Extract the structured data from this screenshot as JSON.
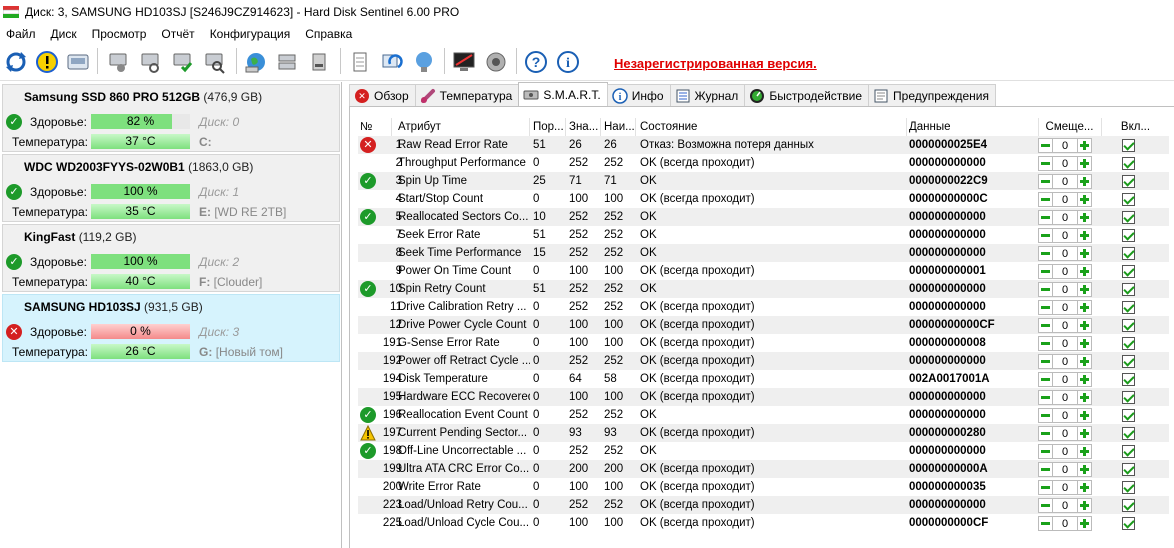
{
  "window": {
    "title": "Диск: 3, SAMSUNG HD103SJ [S246J9CZ914623]  -  Hard Disk Sentinel 6.00 PRO"
  },
  "menu": [
    "Файл",
    "Диск",
    "Просмотр",
    "Отчёт",
    "Конфигурация",
    "Справка"
  ],
  "toolbar": {
    "unregistered": "Незарегистрированная версия."
  },
  "disks": [
    {
      "name": "Samsung SSD 860 PRO 512GB",
      "size": "(476,9 GB)",
      "health_label": "Здоровье:",
      "health": "82 %",
      "health_level": 82,
      "disk_label": "Диск: 0",
      "temp_label": "Температура:",
      "temp": "37 °C",
      "volume_letter": "C:",
      "volume_name": "",
      "status": "ok",
      "selected": false
    },
    {
      "name": "WDC WD2003FYYS-02W0B1",
      "size": "(1863,0 GB)",
      "health_label": "Здоровье:",
      "health": "100 %",
      "health_level": 100,
      "disk_label": "Диск: 1",
      "temp_label": "Температура:",
      "temp": "35 °C",
      "volume_letter": "E:",
      "volume_name": "[WD RE 2TB]",
      "status": "ok",
      "selected": false
    },
    {
      "name": "KingFast",
      "size": "(119,2 GB)",
      "health_label": "Здоровье:",
      "health": "100 %",
      "health_level": 100,
      "disk_label": "Диск: 2",
      "temp_label": "Температура:",
      "temp": "40 °C",
      "volume_letter": "F:",
      "volume_name": "[Clouder]",
      "status": "ok",
      "selected": false
    },
    {
      "name": "SAMSUNG HD103SJ",
      "size": "(931,5 GB)",
      "health_label": "Здоровье:",
      "health": "0 %",
      "health_level": 0,
      "disk_label": "Диск: 3",
      "temp_label": "Температура:",
      "temp": "26 °C",
      "volume_letter": "G:",
      "volume_name": "[Новый том]",
      "status": "bad",
      "selected": true
    }
  ],
  "tabs": [
    {
      "label": "Обзор",
      "icon": "error-icon"
    },
    {
      "label": "Температура",
      "icon": "thermometer-icon"
    },
    {
      "label": "S.M.A.R.T.",
      "icon": "disk-icon",
      "active": true
    },
    {
      "label": "Инфо",
      "icon": "info-icon"
    },
    {
      "label": "Журнал",
      "icon": "log-icon"
    },
    {
      "label": "Быстродействие",
      "icon": "gauge-icon"
    },
    {
      "label": "Предупреждения",
      "icon": "warnings-icon"
    }
  ],
  "smart": {
    "headers": {
      "no": "№",
      "attr": "Атрибут",
      "thr": "Пор...",
      "val": "Зна...",
      "wor": "Наи...",
      "status": "Состояние",
      "data": "Данные",
      "offset": "Смеще...",
      "enabled": "Вкл..."
    },
    "rows": [
      {
        "icon": "bad",
        "no": "1",
        "attr": "Raw Read Error Rate",
        "thr": "51",
        "val": "26",
        "wor": "26",
        "status": "Отказ: Возможна потеря данных",
        "data": "0000000025E4",
        "offset": "0"
      },
      {
        "icon": "",
        "no": "2",
        "attr": "Throughput Performance",
        "thr": "0",
        "val": "252",
        "wor": "252",
        "status": "OK (всегда проходит)",
        "data": "000000000000",
        "offset": "0"
      },
      {
        "icon": "ok",
        "no": "3",
        "attr": "Spin Up Time",
        "thr": "25",
        "val": "71",
        "wor": "71",
        "status": "OK",
        "data": "0000000022C9",
        "offset": "0"
      },
      {
        "icon": "",
        "no": "4",
        "attr": "Start/Stop Count",
        "thr": "0",
        "val": "100",
        "wor": "100",
        "status": "OK (всегда проходит)",
        "data": "00000000000C",
        "offset": "0"
      },
      {
        "icon": "ok",
        "no": "5",
        "attr": "Reallocated Sectors Co...",
        "thr": "10",
        "val": "252",
        "wor": "252",
        "status": "OK",
        "data": "000000000000",
        "offset": "0"
      },
      {
        "icon": "",
        "no": "7",
        "attr": "Seek Error Rate",
        "thr": "51",
        "val": "252",
        "wor": "252",
        "status": "OK",
        "data": "000000000000",
        "offset": "0"
      },
      {
        "icon": "",
        "no": "8",
        "attr": "Seek Time Performance",
        "thr": "15",
        "val": "252",
        "wor": "252",
        "status": "OK",
        "data": "000000000000",
        "offset": "0"
      },
      {
        "icon": "",
        "no": "9",
        "attr": "Power On Time Count",
        "thr": "0",
        "val": "100",
        "wor": "100",
        "status": "OK (всегда проходит)",
        "data": "000000000001",
        "offset": "0"
      },
      {
        "icon": "ok",
        "no": "10",
        "attr": "Spin Retry Count",
        "thr": "51",
        "val": "252",
        "wor": "252",
        "status": "OK",
        "data": "000000000000",
        "offset": "0"
      },
      {
        "icon": "",
        "no": "11",
        "attr": "Drive Calibration Retry ...",
        "thr": "0",
        "val": "252",
        "wor": "252",
        "status": "OK (всегда проходит)",
        "data": "000000000000",
        "offset": "0"
      },
      {
        "icon": "",
        "no": "12",
        "attr": "Drive Power Cycle Count",
        "thr": "0",
        "val": "100",
        "wor": "100",
        "status": "OK (всегда проходит)",
        "data": "00000000000CF",
        "offset": "0"
      },
      {
        "icon": "",
        "no": "191",
        "attr": "G-Sense Error Rate",
        "thr": "0",
        "val": "100",
        "wor": "100",
        "status": "OK (всегда проходит)",
        "data": "000000000008",
        "offset": "0"
      },
      {
        "icon": "",
        "no": "192",
        "attr": "Power off Retract Cycle ...",
        "thr": "0",
        "val": "252",
        "wor": "252",
        "status": "OK (всегда проходит)",
        "data": "000000000000",
        "offset": "0"
      },
      {
        "icon": "",
        "no": "194",
        "attr": "Disk Temperature",
        "thr": "0",
        "val": "64",
        "wor": "58",
        "status": "OK (всегда проходит)",
        "data": "002A0017001A",
        "offset": "0"
      },
      {
        "icon": "",
        "no": "195",
        "attr": "Hardware ECC Recovered",
        "thr": "0",
        "val": "100",
        "wor": "100",
        "status": "OK (всегда проходит)",
        "data": "000000000000",
        "offset": "0"
      },
      {
        "icon": "ok",
        "no": "196",
        "attr": "Reallocation Event Count",
        "thr": "0",
        "val": "252",
        "wor": "252",
        "status": "OK",
        "data": "000000000000",
        "offset": "0"
      },
      {
        "icon": "warn",
        "no": "197",
        "attr": "Current Pending Sector...",
        "thr": "0",
        "val": "93",
        "wor": "93",
        "status": "OK (всегда проходит)",
        "data": "000000000280",
        "offset": "0"
      },
      {
        "icon": "ok",
        "no": "198",
        "attr": "Off-Line Uncorrectable ...",
        "thr": "0",
        "val": "252",
        "wor": "252",
        "status": "OK",
        "data": "000000000000",
        "offset": "0"
      },
      {
        "icon": "",
        "no": "199",
        "attr": "Ultra ATA CRC Error Co...",
        "thr": "0",
        "val": "200",
        "wor": "200",
        "status": "OK (всегда проходит)",
        "data": "00000000000A",
        "offset": "0"
      },
      {
        "icon": "",
        "no": "200",
        "attr": "Write Error Rate",
        "thr": "0",
        "val": "100",
        "wor": "100",
        "status": "OK (всегда проходит)",
        "data": "000000000035",
        "offset": "0"
      },
      {
        "icon": "",
        "no": "223",
        "attr": "Load/Unload Retry Cou...",
        "thr": "0",
        "val": "252",
        "wor": "252",
        "status": "OK (всегда проходит)",
        "data": "000000000000",
        "offset": "0"
      },
      {
        "icon": "",
        "no": "225",
        "attr": "Load/Unload Cycle Cou...",
        "thr": "0",
        "val": "100",
        "wor": "100",
        "status": "OK (всегда проходит)",
        "data": "0000000000CF",
        "offset": "0"
      }
    ]
  },
  "colors": {
    "ok": "#1d9a2a",
    "bad": "#d42020",
    "warn": "#f5c400",
    "selected_disk": "#d6f3fd",
    "unregistered": "#e00000"
  }
}
